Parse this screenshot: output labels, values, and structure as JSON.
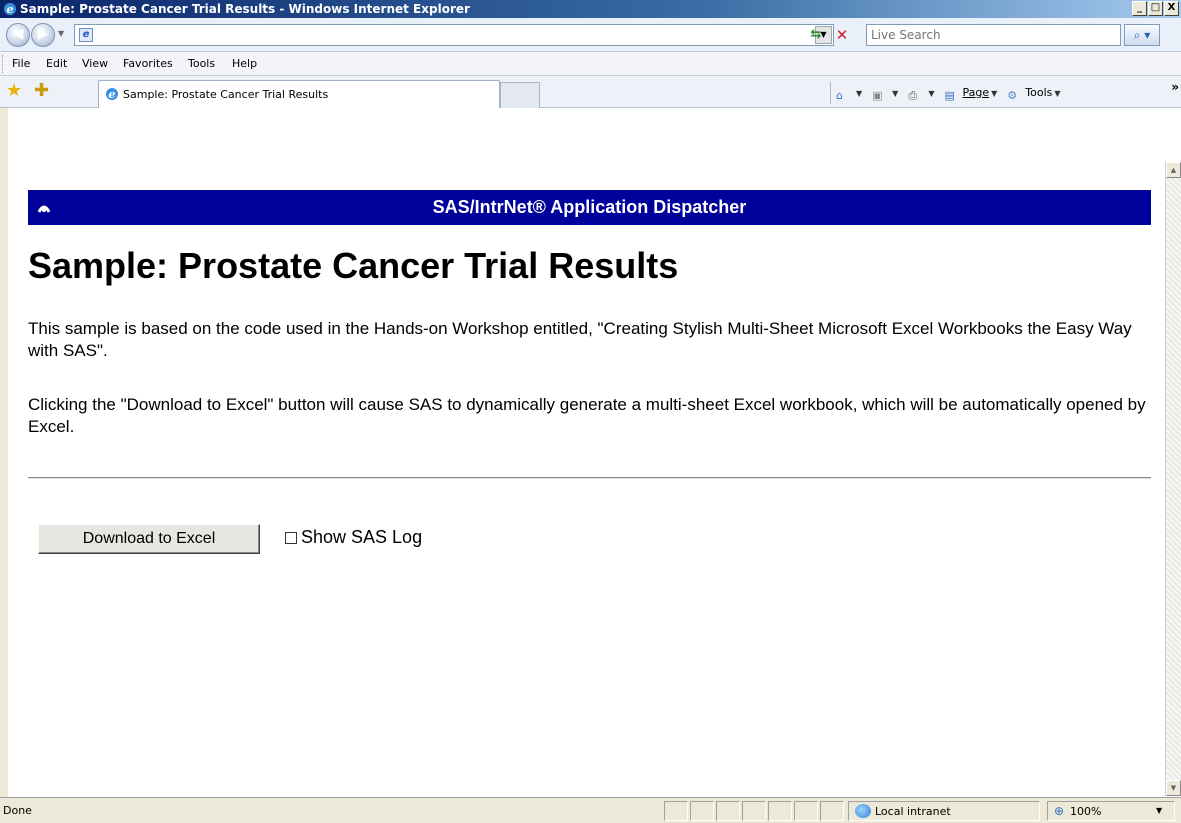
{
  "window": {
    "title": "Sample: Prostate Cancer Trial Results - Windows Internet Explorer",
    "controls": [
      "_",
      "□",
      "X"
    ]
  },
  "toolbar": {
    "address_value": "",
    "search_placeholder": "Live Search"
  },
  "menubar": {
    "items": [
      "File",
      "Edit",
      "View",
      "Favorites",
      "Tools",
      "Help"
    ]
  },
  "tabs": {
    "active_label": "Sample: Prostate Cancer Trial Results"
  },
  "commandbar": {
    "page_label": "Page",
    "tools_label": "Tools",
    "overflow": "»"
  },
  "page": {
    "banner_title": "SAS/IntrNet® Application Dispatcher",
    "heading": "Sample: Prostate Cancer Trial Results",
    "para1": "This sample is based on the code used in the Hands-on Workshop entitled, \"Creating Stylish Multi-Sheet Microsoft Excel Workbooks the Easy Way with SAS\".",
    "para2": "Clicking the \"Download to Excel\" button will cause SAS to dynamically generate a multi-sheet Excel workbook, which will be automatically opened by Excel.",
    "download_button": "Download to Excel",
    "show_log_label": "Show SAS Log",
    "show_log_checked": false
  },
  "status": {
    "text": "Done",
    "zone": "Local intranet",
    "zoom": "100%"
  },
  "colors": {
    "banner": "#00009a",
    "titlebar": "#0a246a"
  }
}
